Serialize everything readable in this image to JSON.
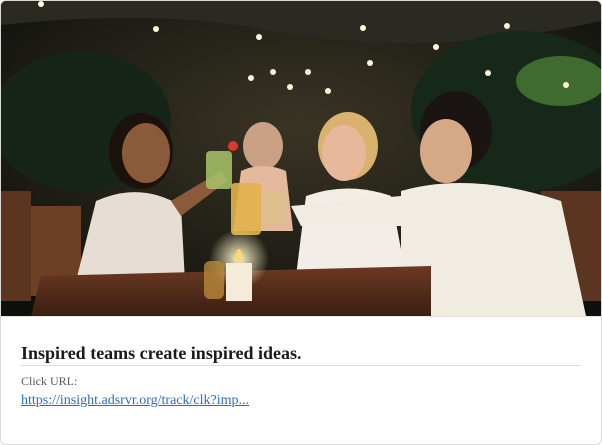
{
  "ad": {
    "image_alt": "Friends toasting with cocktails at an outdoor evening table",
    "headline": "Inspired teams create inspired ideas.",
    "click_url_label": "Click URL:",
    "click_url": "https://insight.adsrvr.org/track/clk?imp..."
  },
  "colors": {
    "link": "#2a6fb8",
    "headline": "#1a1a1a",
    "label": "#5a5a5a",
    "border": "#d9d9d9"
  }
}
